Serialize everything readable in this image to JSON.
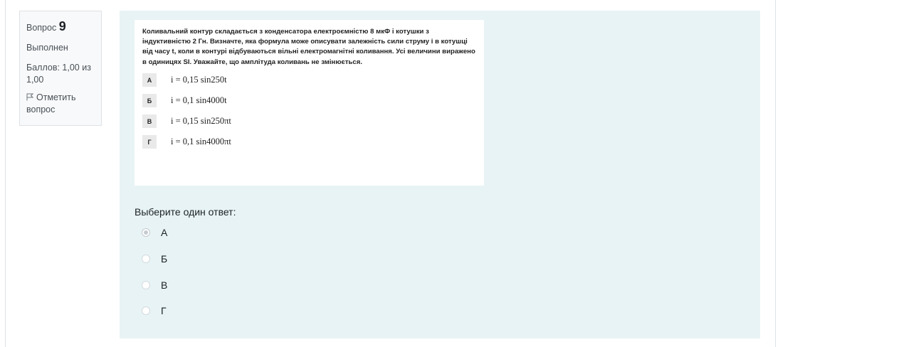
{
  "info": {
    "question_label": "Вопрос",
    "question_number": "9",
    "state": "Выполнен",
    "grade": "Баллов: 1,00 из 1,00",
    "flag_label": "Отметить вопрос",
    "flag_icon": "flag-icon"
  },
  "question": {
    "text": "Коливальний контур складається з конденсатора електроємністю 8 мкФ і котушки з індуктивністю 2 Гн. Визначте, яка формула може описувати залежність сили струму i в котушці від часу t, коли в контурі відбуваються вільні електромагнітні коливання. Усі величини виражено в одиницях SI. Уважайте, що амплітуда коливань не змінюється.",
    "options": [
      {
        "letter": "А",
        "formula": "i = 0,15 sin250t"
      },
      {
        "letter": "Б",
        "formula": "i = 0,1 sin4000t"
      },
      {
        "letter": "В",
        "formula": "i = 0,15 sin250πt"
      },
      {
        "letter": "Г",
        "formula": "i = 0,1 sin4000πt"
      }
    ]
  },
  "prompt": "Выберите один ответ:",
  "answers": [
    {
      "label": "А",
      "selected": true
    },
    {
      "label": "Б",
      "selected": false
    },
    {
      "label": "В",
      "selected": false
    },
    {
      "label": "Г",
      "selected": false
    }
  ],
  "colors": {
    "content_background": "#e7f3f5",
    "info_background": "#f8f9fa"
  }
}
